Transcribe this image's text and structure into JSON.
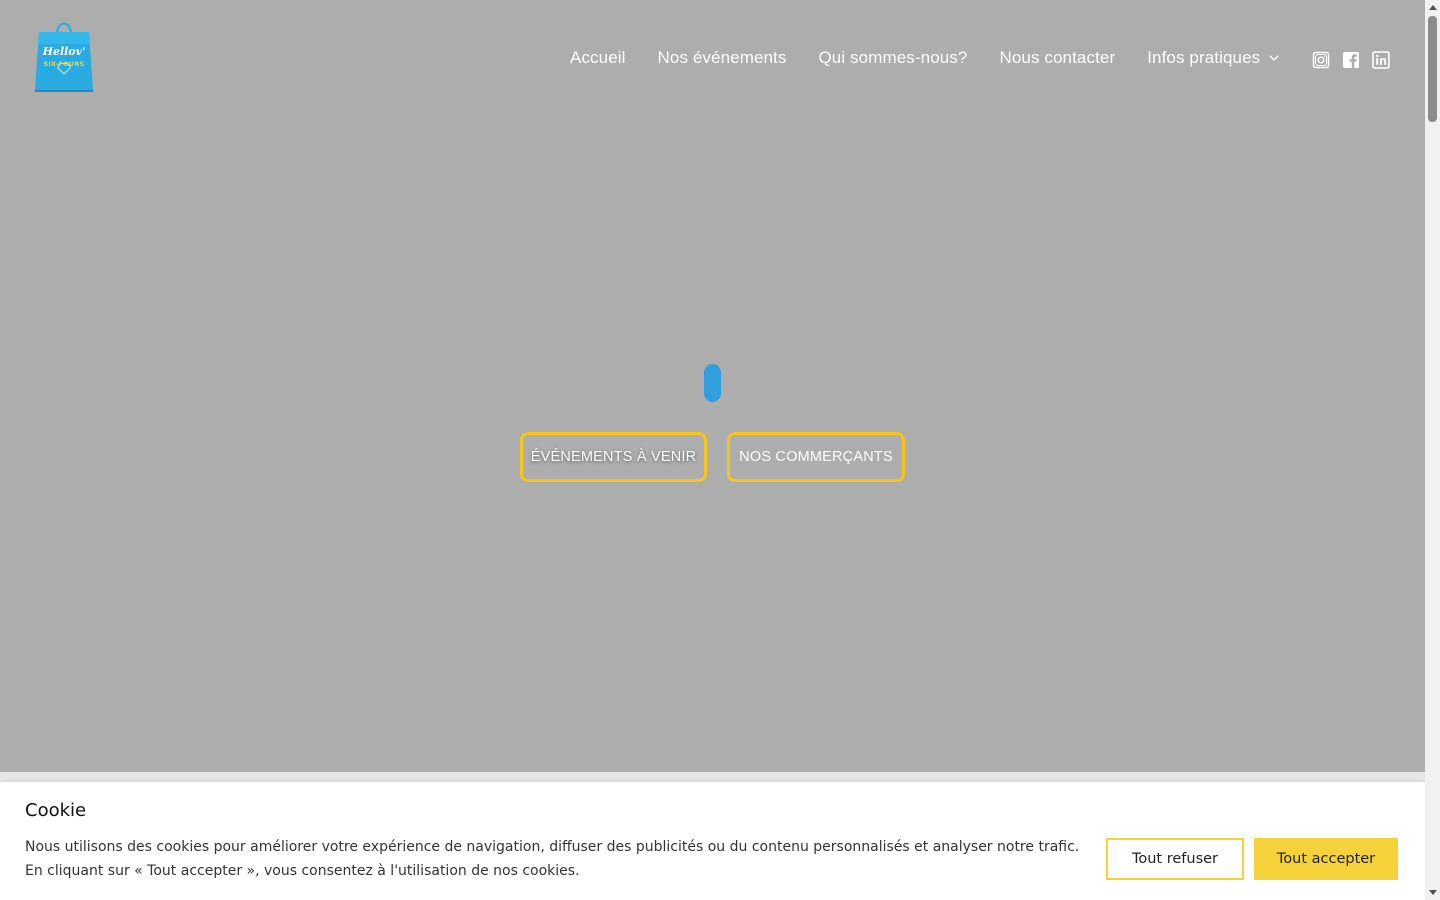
{
  "logo": {
    "title": "Hellov'",
    "subtitle": "SIX-FOURS",
    "tagline": "",
    "icon": "shopping-bag-icon",
    "colors": {
      "bag": "#29aae1",
      "accent": "#f5d23a"
    }
  },
  "nav": {
    "items": [
      {
        "label": "Accueil"
      },
      {
        "label": "Nos événements"
      },
      {
        "label": "Qui sommes-nous?"
      },
      {
        "label": "Nous contacter"
      },
      {
        "label": "Infos pratiques",
        "icon": "chevron-down-icon"
      }
    ]
  },
  "social": {
    "icons": [
      "instagram-icon",
      "facebook-icon",
      "linkedin-icon"
    ]
  },
  "hero": {
    "background": "#adadad",
    "loader_color": "#2f9fde",
    "buttons": {
      "events_label": "ÉVÉNEMENTS À VENIR",
      "merchants_label": "NOS COMMERÇANTS"
    },
    "button_border_color": "#f5c518"
  },
  "cookie": {
    "title": "Cookie",
    "text": "Nous utilisons des cookies pour améliorer votre expérience de navigation, diffuser des publicités ou du contenu personnalisés et analyser notre trafic. En cliquant sur « Tout accepter », vous consentez à l'utilisation de nos cookies.",
    "refuse_label": "Tout refuser",
    "accept_label": "Tout accepter",
    "accent_color": "#f5d23a"
  }
}
